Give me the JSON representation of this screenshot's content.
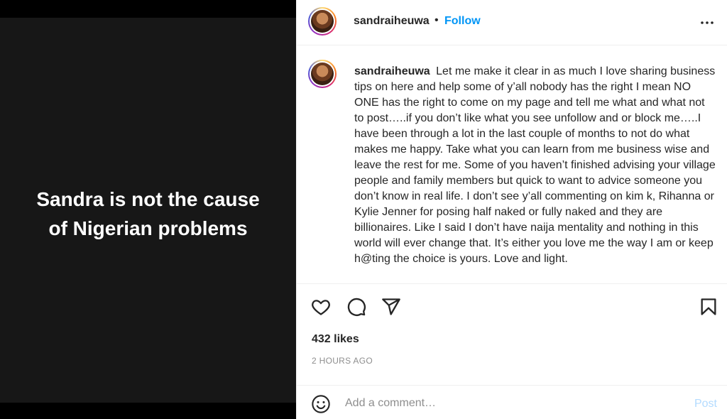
{
  "media": {
    "caption_line1": "Sandra is not the cause",
    "caption_line2": "of Nigerian problems"
  },
  "header": {
    "username": "sandraiheuwa",
    "separator": "•",
    "follow_label": "Follow",
    "more_icon": "more-horizontal-icon"
  },
  "caption": {
    "username": "sandraiheuwa",
    "text": "Let me make it clear in as much I love sharing business tips on here and help some of y’all nobody has the right I mean NO ONE has the right to come on my page and tell me what and what not to post…..if you don’t like what you see unfollow and or block me…..I have been through a lot in the last couple of months to not do what makes me happy. Take what you can learn from me business wise and leave the rest for me. Some of you haven’t finished advising your village people and family members but quick to want to advice someone you don’t know in real life. I don’t see y’all commenting on kim k, Rihanna or Kylie Jenner for posing half naked or fully naked and they are billionaires. Like I said I don’t have naija mentality and nothing in this world will ever change that. It’s either you love me the way I am or keep h@ting the choice is yours. Love and light."
  },
  "actions": {
    "like_icon": "heart-icon",
    "comment_icon": "comment-icon",
    "share_icon": "paper-plane-icon",
    "save_icon": "bookmark-icon"
  },
  "likes": "432 likes",
  "timestamp": "2 HOURS AGO",
  "comment_box": {
    "emoji_icon": "emoji-icon",
    "placeholder": "Add a comment…",
    "post_label": "Post"
  },
  "colors": {
    "accent": "#0095f6",
    "post_disabled": "#b3dbff",
    "media_background": "#171717"
  }
}
